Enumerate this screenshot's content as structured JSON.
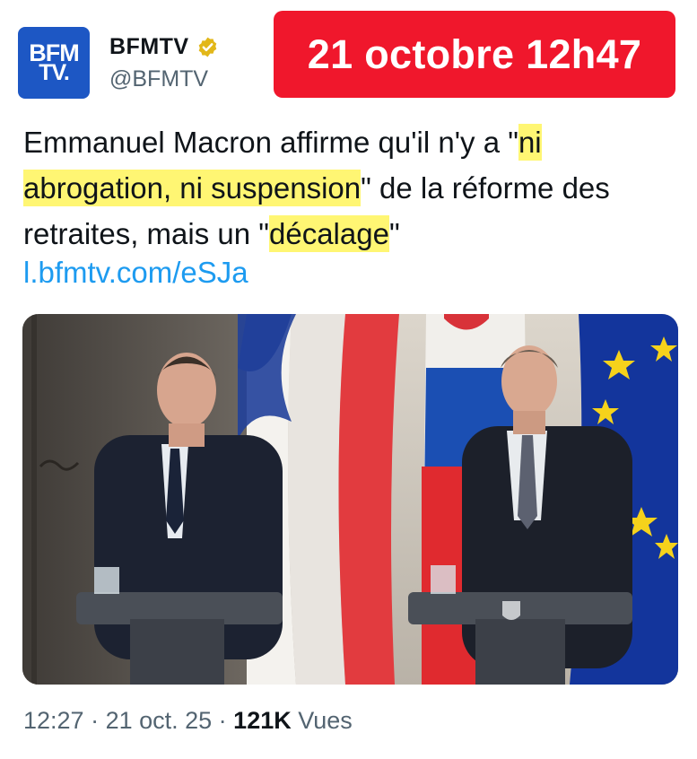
{
  "author": {
    "avatar_line1": "BFM",
    "avatar_line2": "TV.",
    "name": "BFMTV",
    "handle": "@BFMTV",
    "verified_badge_icon": "gold-verified-badge-icon",
    "avatar_color": "#1d57c4"
  },
  "overlay": {
    "date_banner": "21 octobre 12h47",
    "banner_color": "#f0172c"
  },
  "tweet": {
    "text_part1": "Emmanuel Macron affirme qu'il n'y a \"",
    "text_hl1": "ni",
    "text_break": " ",
    "text_hl2": "abrogation, ni suspension",
    "text_part2": "\" de la réforme des retraites, mais un \"",
    "text_hl3": "décalage",
    "text_part3": "\"",
    "link": "l.bfmtv.com/eSJa",
    "highlight_color": "#fff45a"
  },
  "media": {
    "image_icon": "press-conference-photo",
    "scene": "two-leaders-at-podiums-with-flags"
  },
  "meta": {
    "time": "12:27",
    "sep1": " · ",
    "date": "21 oct. 25",
    "sep2": " · ",
    "views_count": "121K",
    "views_label": " Vues"
  }
}
